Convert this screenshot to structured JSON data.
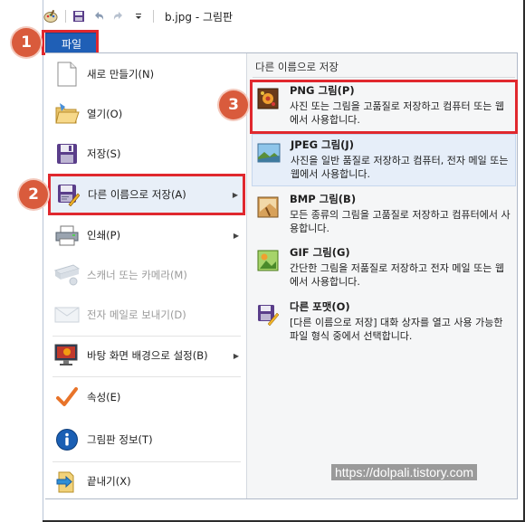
{
  "window": {
    "title": "b.jpg - 그림판"
  },
  "quick_access": {
    "icons": [
      "paint-app-icon",
      "save-icon",
      "undo-icon",
      "redo-icon",
      "customize-dropdown-icon"
    ]
  },
  "file_tab": {
    "label": "파일"
  },
  "left_menu": {
    "items": [
      {
        "label": "새로 만들기(N)",
        "icon": "new-document-icon",
        "disabled": false,
        "submenu": false
      },
      {
        "label": "열기(O)",
        "icon": "open-folder-icon",
        "disabled": false,
        "submenu": false
      },
      {
        "label": "저장(S)",
        "icon": "save-icon",
        "disabled": false,
        "submenu": false
      },
      {
        "label": "다른 이름으로 저장(A)",
        "icon": "save-as-icon",
        "disabled": false,
        "submenu": true
      },
      {
        "label": "인쇄(P)",
        "icon": "printer-icon",
        "disabled": false,
        "submenu": true
      },
      {
        "label": "스캐너 또는 카메라(M)",
        "icon": "scanner-icon",
        "disabled": true,
        "submenu": false
      },
      {
        "label": "전자 메일로 보내기(D)",
        "icon": "email-icon",
        "disabled": true,
        "submenu": false
      },
      {
        "label": "바탕 화면 배경으로 설정(B)",
        "icon": "desktop-background-icon",
        "disabled": false,
        "submenu": true
      },
      {
        "label": "속성(E)",
        "icon": "checkmark-icon",
        "disabled": false,
        "submenu": false
      },
      {
        "label": "그림판 정보(T)",
        "icon": "info-icon",
        "disabled": false,
        "submenu": false
      },
      {
        "label": "끝내기(X)",
        "icon": "exit-icon",
        "disabled": false,
        "submenu": false
      }
    ]
  },
  "save_as_submenu": {
    "header": "다른 이름으로 저장",
    "items": [
      {
        "name": "PNG 그림(P)",
        "description": "사진 또는 그림을 고품질로 저장하고 컴퓨터 또는 웹에서 사용합니다.",
        "icon": "png-image-icon"
      },
      {
        "name": "JPEG 그림(J)",
        "description": "사진을 일반 품질로 저장하고 컴퓨터, 전자 메일 또는 웹에서 사용합니다.",
        "icon": "jpeg-image-icon"
      },
      {
        "name": "BMP 그림(B)",
        "description": "모든 종류의 그림을 고품질로 저장하고 컴퓨터에서 사용합니다.",
        "icon": "bmp-image-icon"
      },
      {
        "name": "GIF 그림(G)",
        "description": "간단한 그림을 저품질로 저장하고 전자 메일 또는 웹에서 사용합니다.",
        "icon": "gif-image-icon"
      },
      {
        "name": "다른 포맷(O)",
        "description": "[다른 이름으로 저장] 대화 상자를 열고 사용 가능한 파일 형식 중에서 선택합니다.",
        "icon": "other-format-icon"
      }
    ]
  },
  "annotations": {
    "badges": [
      "1",
      "2",
      "3"
    ]
  },
  "watermark": "https://dolpali.tistory.com",
  "colors": {
    "file_tab": "#1f5fb6",
    "highlight_box": "#e0282e",
    "badge": "#d95b3c",
    "selected_row": "#e6eef9"
  }
}
